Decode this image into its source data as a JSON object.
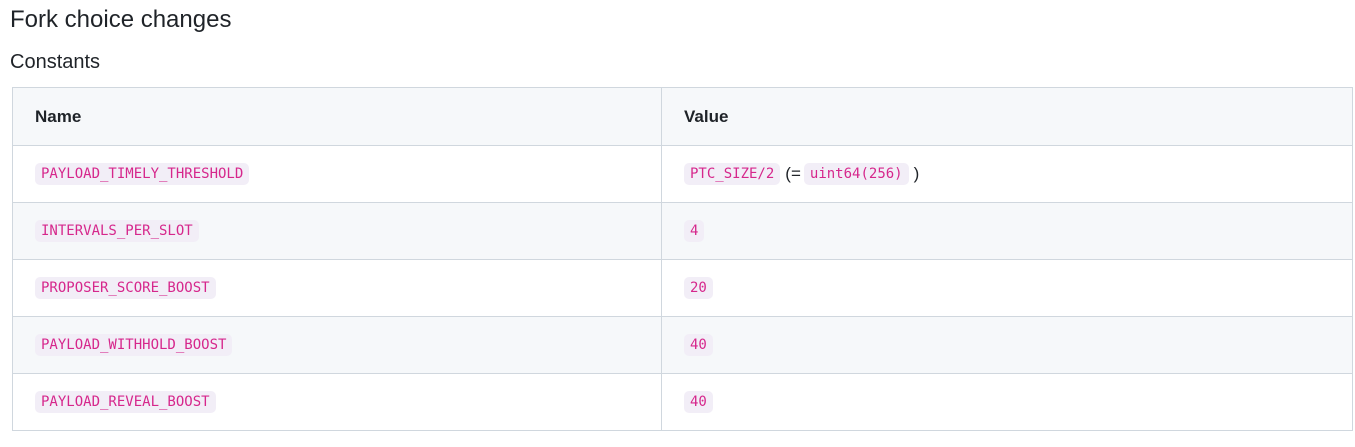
{
  "heading": "Fork choice changes",
  "subheading": "Constants",
  "table": {
    "headers": {
      "name": "Name",
      "value": "Value"
    },
    "rows": [
      {
        "name": "PAYLOAD_TIMELY_THRESHOLD",
        "value": "PTC_SIZE/2",
        "note_open": "(=",
        "note_value": "uint64(256)",
        "note_close": ")"
      },
      {
        "name": "INTERVALS_PER_SLOT",
        "value": "4"
      },
      {
        "name": "PROPOSER_SCORE_BOOST",
        "value": "20"
      },
      {
        "name": "PAYLOAD_WITHHOLD_BOOST",
        "value": "40"
      },
      {
        "name": "PAYLOAD_REVEAL_BOOST",
        "value": "40"
      }
    ]
  },
  "colors": {
    "code_text": "#d6278c",
    "code_background": "#f2eef7",
    "header_background": "#f6f8fa",
    "border": "#d0d7de"
  }
}
